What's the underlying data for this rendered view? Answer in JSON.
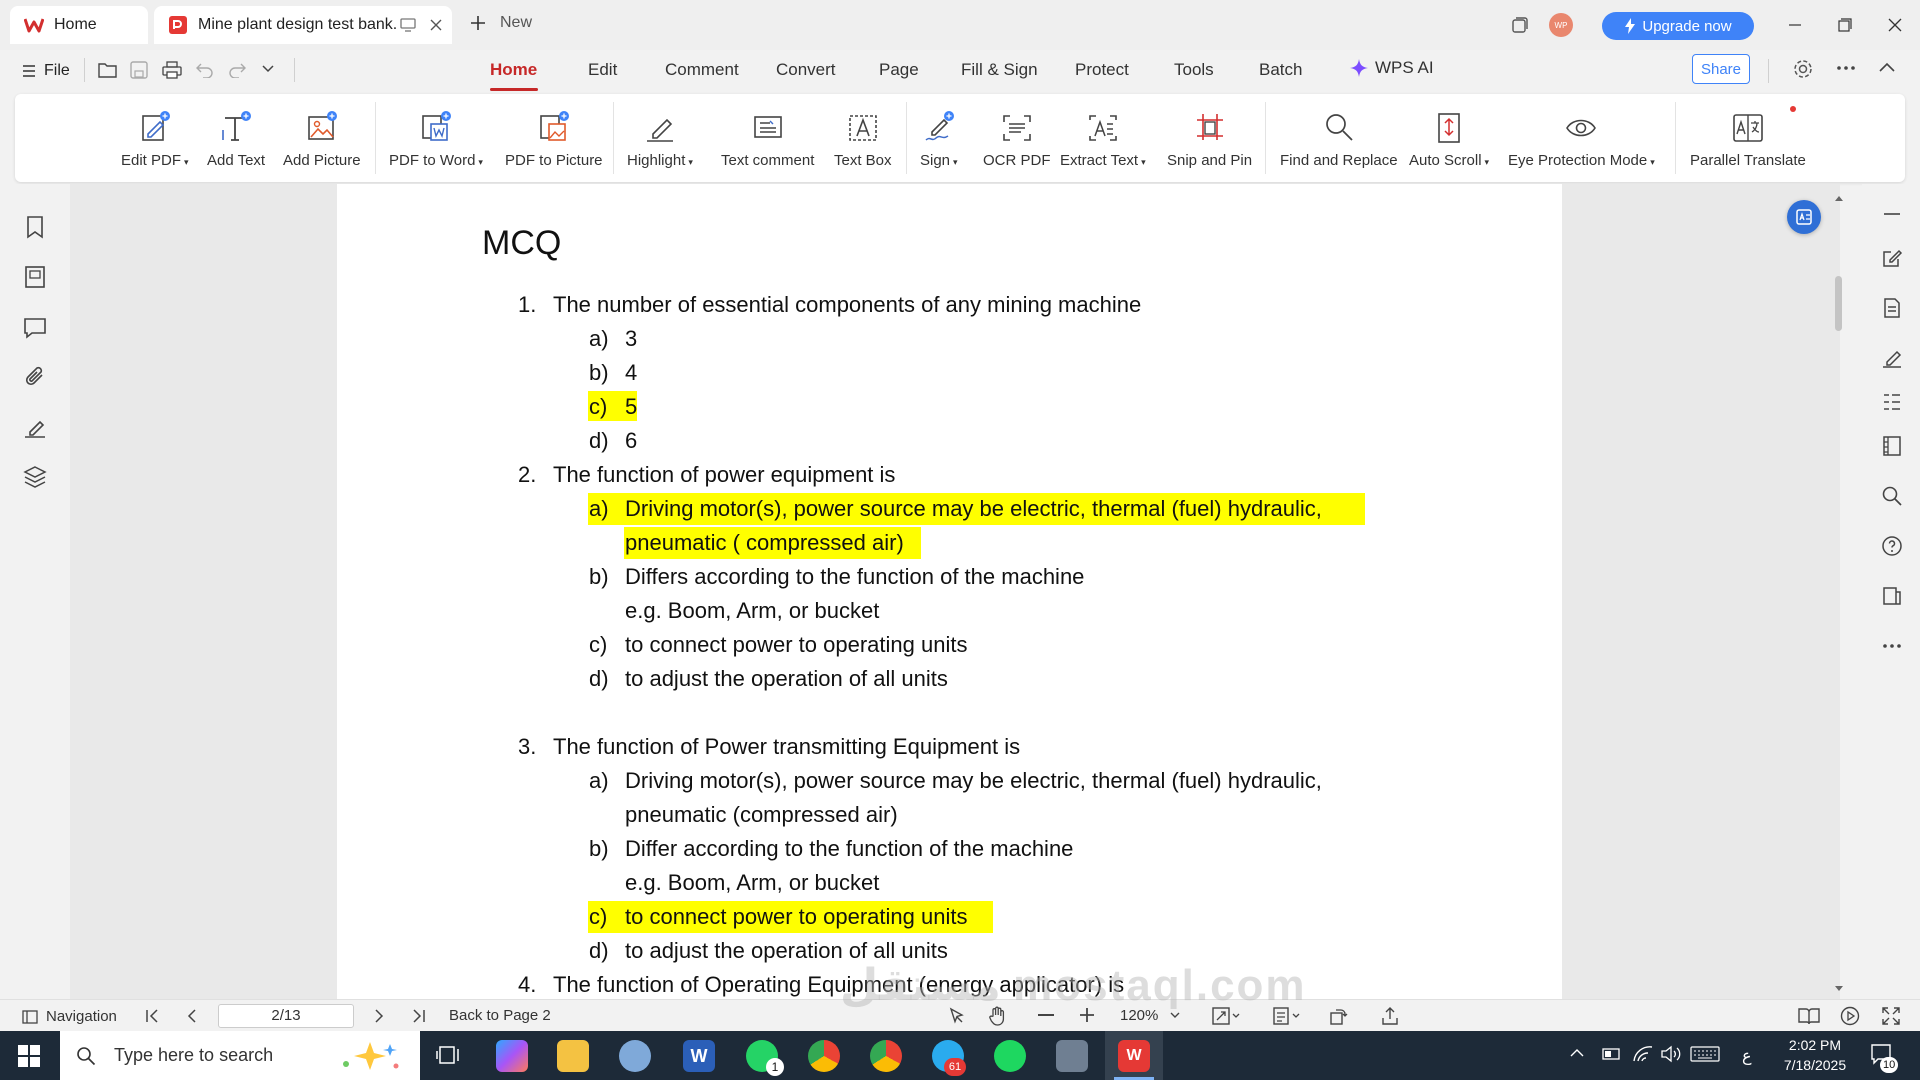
{
  "tabs": {
    "home_label": "Home",
    "doc_label": "Mine plant design test bank.pdf",
    "new_label": "New"
  },
  "title_bar": {
    "avatar_text": "WP",
    "upgrade_label": "Upgrade now"
  },
  "menu": {
    "file_label": "File",
    "items": [
      "Home",
      "Edit",
      "Comment",
      "Convert",
      "Page",
      "Fill & Sign",
      "Protect",
      "Tools",
      "Batch",
      "WPS AI"
    ],
    "active": "Home",
    "share_label": "Share"
  },
  "ribbon": {
    "tools": [
      {
        "label": "Edit PDF",
        "icon": "edit-pdf-icon",
        "dropdown": true
      },
      {
        "label": "Add Text",
        "icon": "add-text-icon",
        "dropdown": false
      },
      {
        "label": "Add Picture",
        "icon": "add-picture-icon",
        "dropdown": false
      },
      {
        "label": "PDF to Word",
        "icon": "pdf-to-word-icon",
        "dropdown": true
      },
      {
        "label": "PDF to Picture",
        "icon": "pdf-to-picture-icon",
        "dropdown": false
      },
      {
        "label": "Highlight",
        "icon": "highlight-icon",
        "dropdown": true
      },
      {
        "label": "Text comment",
        "icon": "text-comment-icon",
        "dropdown": false
      },
      {
        "label": "Text Box",
        "icon": "text-box-icon",
        "dropdown": false
      },
      {
        "label": "Sign",
        "icon": "sign-icon",
        "dropdown": true
      },
      {
        "label": "OCR PDF",
        "icon": "ocr-icon",
        "dropdown": false
      },
      {
        "label": "Extract Text",
        "icon": "extract-text-icon",
        "dropdown": true
      },
      {
        "label": "Snip and Pin",
        "icon": "snip-pin-icon",
        "dropdown": false
      },
      {
        "label": "Find and Replace",
        "icon": "find-replace-icon",
        "dropdown": false
      },
      {
        "label": "Auto Scroll",
        "icon": "auto-scroll-icon",
        "dropdown": true
      },
      {
        "label": "Eye Protection Mode",
        "icon": "eye-protection-icon",
        "dropdown": true
      },
      {
        "label": "Parallel Translate",
        "icon": "parallel-translate-icon",
        "dropdown": false
      }
    ]
  },
  "document": {
    "heading": "MCQ",
    "q1": {
      "num": "1.",
      "text": "The number of essential components of any mining machine",
      "a": {
        "letter": "a)",
        "text": "3"
      },
      "b": {
        "letter": "b)",
        "text": "4"
      },
      "c": {
        "letter": "c)",
        "text": "5"
      },
      "d": {
        "letter": "d)",
        "text": "6"
      }
    },
    "q2": {
      "num": "2.",
      "text": "The function of   power equipment is",
      "a": {
        "letter": "a)",
        "line1": "Driving motor(s), power source may be electric, thermal (fuel) hydraulic,",
        "line2": "pneumatic ( compressed air)"
      },
      "b": {
        "letter": "b)",
        "line1": "Differs according to the function of the machine",
        "line2": "e.g. Boom, Arm, or bucket"
      },
      "c": {
        "letter": "c)",
        "text": "to connect power to operating units"
      },
      "d": {
        "letter": "d)",
        "text": "to adjust the operation of all units"
      }
    },
    "q3": {
      "num": "3.",
      "text": "The function of   Power transmitting Equipment is",
      "a": {
        "letter": "a)",
        "line1": "Driving motor(s), power source may be electric, thermal (fuel) hydraulic,",
        "line2": "pneumatic (compressed air)"
      },
      "b": {
        "letter": "b)",
        "line1": "Differ according to the function of the machine",
        "line2": "e.g. Boom, Arm, or bucket"
      },
      "c": {
        "letter": "c)",
        "text": "to connect power to operating units"
      },
      "d": {
        "letter": "d)",
        "text": "to adjust the operation of all units"
      }
    },
    "q4": {
      "num": "4.",
      "text": "The function of   Operating Equipment (energy applicator) is"
    },
    "highlight_color": "#ffff00"
  },
  "status_bar": {
    "navigation_label": "Navigation",
    "page_value": "2/13",
    "back_label": "Back to Page 2",
    "zoom": "120%"
  },
  "taskbar": {
    "search_placeholder": "Type here to search",
    "whatsapp_badge": "1",
    "telegram_badge": "61",
    "time": "2:02 PM",
    "date": "7/18/2025",
    "lang": "ع",
    "notification_count": "10"
  },
  "watermark": "مستقل mostaql.com",
  "colors": {
    "accent": "#c62828",
    "upgrade": "#3f83f8",
    "taskbar": "#1d2a38"
  }
}
